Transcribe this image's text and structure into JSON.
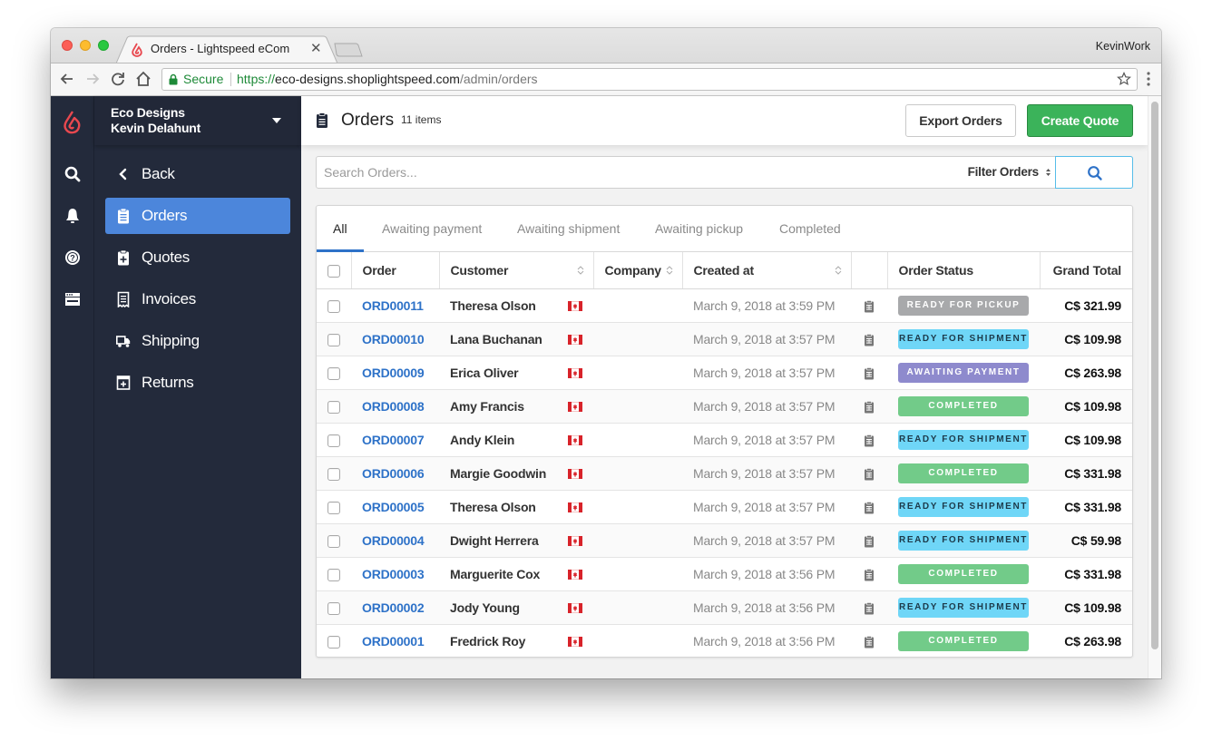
{
  "browser": {
    "tab_title": "Orders - Lightspeed eCom",
    "profile_name": "KevinWork",
    "secure_label": "Secure",
    "url_scheme": "https://",
    "url_host": "eco-designs.shoplightspeed.com",
    "url_path": "/admin/orders"
  },
  "rail": {
    "icons": [
      "lightspeed-logo",
      "search-icon",
      "bell-icon",
      "help-icon",
      "store-icon"
    ]
  },
  "sidebar": {
    "store_name": "Eco Designs",
    "user_name": "Kevin Delahunt",
    "items": [
      {
        "label": "Back",
        "icon": "chevron-left-icon",
        "active": false
      },
      {
        "label": "Orders",
        "icon": "clipboard-icon",
        "active": true
      },
      {
        "label": "Quotes",
        "icon": "clipboard-plus-icon",
        "active": false
      },
      {
        "label": "Invoices",
        "icon": "receipt-icon",
        "active": false
      },
      {
        "label": "Shipping",
        "icon": "truck-icon",
        "active": false
      },
      {
        "label": "Returns",
        "icon": "return-box-icon",
        "active": false
      }
    ]
  },
  "header": {
    "title": "Orders",
    "count": "11 items",
    "export_label": "Export Orders",
    "create_label": "Create Quote"
  },
  "search": {
    "placeholder": "Search Orders...",
    "value": "",
    "filter_label": "Filter Orders"
  },
  "tabs": [
    {
      "label": "All",
      "active": true
    },
    {
      "label": "Awaiting payment",
      "active": false
    },
    {
      "label": "Awaiting shipment",
      "active": false
    },
    {
      "label": "Awaiting pickup",
      "active": false
    },
    {
      "label": "Completed",
      "active": false
    }
  ],
  "table": {
    "columns": [
      "Order",
      "Customer",
      "Company",
      "Created at",
      "",
      "Order Status",
      "Grand Total"
    ],
    "rows": [
      {
        "order": "ORD00011",
        "customer": "Theresa Olson",
        "company": "",
        "created": "March 9, 2018 at 3:59 PM",
        "status": "READY FOR PICKUP",
        "status_key": "pickup",
        "total": "C$ 321.99"
      },
      {
        "order": "ORD00010",
        "customer": "Lana Buchanan",
        "company": "",
        "created": "March 9, 2018 at 3:57 PM",
        "status": "READY FOR SHIPMENT",
        "status_key": "shipment",
        "total": "C$ 109.98"
      },
      {
        "order": "ORD00009",
        "customer": "Erica Oliver",
        "company": "",
        "created": "March 9, 2018 at 3:57 PM",
        "status": "AWAITING PAYMENT",
        "status_key": "payment",
        "total": "C$ 263.98"
      },
      {
        "order": "ORD00008",
        "customer": "Amy Francis",
        "company": "",
        "created": "March 9, 2018 at 3:57 PM",
        "status": "COMPLETED",
        "status_key": "completed",
        "total": "C$ 109.98"
      },
      {
        "order": "ORD00007",
        "customer": "Andy Klein",
        "company": "",
        "created": "March 9, 2018 at 3:57 PM",
        "status": "READY FOR SHIPMENT",
        "status_key": "shipment",
        "total": "C$ 109.98"
      },
      {
        "order": "ORD00006",
        "customer": "Margie Goodwin",
        "company": "",
        "created": "March 9, 2018 at 3:57 PM",
        "status": "COMPLETED",
        "status_key": "completed",
        "total": "C$ 331.98"
      },
      {
        "order": "ORD00005",
        "customer": "Theresa Olson",
        "company": "",
        "created": "March 9, 2018 at 3:57 PM",
        "status": "READY FOR SHIPMENT",
        "status_key": "shipment",
        "total": "C$ 331.98"
      },
      {
        "order": "ORD00004",
        "customer": "Dwight Herrera",
        "company": "",
        "created": "March 9, 2018 at 3:57 PM",
        "status": "READY FOR SHIPMENT",
        "status_key": "shipment",
        "total": "C$ 59.98"
      },
      {
        "order": "ORD00003",
        "customer": "Marguerite Cox",
        "company": "",
        "created": "March 9, 2018 at 3:56 PM",
        "status": "COMPLETED",
        "status_key": "completed",
        "total": "C$ 331.98"
      },
      {
        "order": "ORD00002",
        "customer": "Jody Young",
        "company": "",
        "created": "March 9, 2018 at 3:56 PM",
        "status": "READY FOR SHIPMENT",
        "status_key": "shipment",
        "total": "C$ 109.98"
      },
      {
        "order": "ORD00001",
        "customer": "Fredrick Roy",
        "company": "",
        "created": "March 9, 2018 at 3:56 PM",
        "status": "COMPLETED",
        "status_key": "completed",
        "total": "C$ 263.98"
      }
    ]
  },
  "status_colors": {
    "pickup": {
      "bg": "#a8a9ab",
      "fg": "#ffffff"
    },
    "shipment": {
      "bg": "#6fd6f7",
      "fg": "#1d3a4a"
    },
    "payment": {
      "bg": "#8e8acd",
      "fg": "#ffffff"
    },
    "completed": {
      "bg": "#72cb89",
      "fg": "#ffffff"
    }
  },
  "colors": {
    "accent": "#4c86db",
    "link": "#2e72c8",
    "primary_button": "#3bb35a",
    "sidebar_bg": "#232a3b",
    "brand_red": "#e8484f"
  }
}
